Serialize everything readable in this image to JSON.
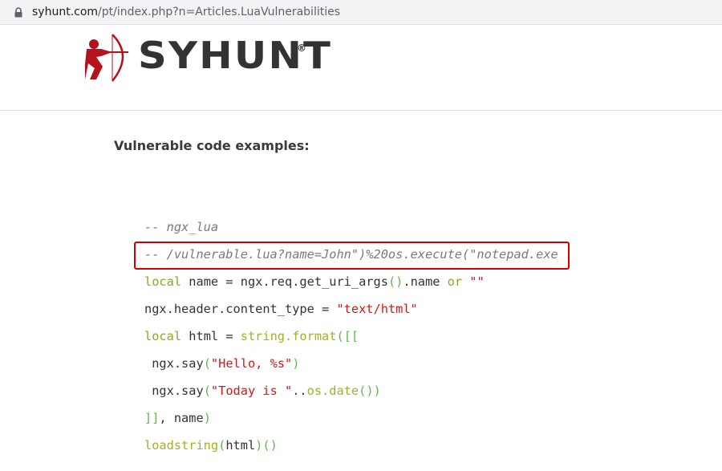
{
  "address_bar": {
    "domain": "syhunt.com",
    "path": "/pt/index.php?n=Articles.LuaVulnerabilities",
    "lock_icon": "lock-icon"
  },
  "header": {
    "logo_text": "SYHUNT",
    "logo_registered": "®",
    "logo_color": "#b5121b"
  },
  "content": {
    "heading": "Vulnerable code examples:",
    "code_lines": [
      {
        "tokens": [
          {
            "t": "-- ngx_lua",
            "c": "comment"
          }
        ]
      },
      {
        "tokens": [
          {
            "t": "-- /vulnerable.lua?name=John\")%20os.execute(\"notepad.exe",
            "c": "comment"
          }
        ],
        "highlighted": true
      },
      {
        "tokens": [
          {
            "t": "local",
            "c": "kw"
          },
          {
            "t": " name = ngx.req.get_uri_args",
            "c": "plain"
          },
          {
            "t": "()",
            "c": "punc"
          },
          {
            "t": ".name ",
            "c": "plain"
          },
          {
            "t": "or",
            "c": "kw"
          },
          {
            "t": " ",
            "c": "plain"
          },
          {
            "t": "\"\"",
            "c": "str"
          }
        ]
      },
      {
        "tokens": [
          {
            "t": "ngx.header.content_type = ",
            "c": "plain"
          },
          {
            "t": "\"text/html\"",
            "c": "str"
          }
        ]
      },
      {
        "tokens": [
          {
            "t": "local",
            "c": "kw"
          },
          {
            "t": " html = ",
            "c": "plain"
          },
          {
            "t": "string.format",
            "c": "fn"
          },
          {
            "t": "([[",
            "c": "punc"
          }
        ]
      },
      {
        "tokens": [
          {
            "t": " ngx.say",
            "c": "plain"
          },
          {
            "t": "(",
            "c": "punc"
          },
          {
            "t": "\"Hello, %s\"",
            "c": "str"
          },
          {
            "t": ")",
            "c": "punc"
          }
        ]
      },
      {
        "tokens": [
          {
            "t": " ngx.say",
            "c": "plain"
          },
          {
            "t": "(",
            "c": "punc"
          },
          {
            "t": "\"Today is \"",
            "c": "str"
          },
          {
            "t": "..",
            "c": "plain"
          },
          {
            "t": "os.date",
            "c": "fn"
          },
          {
            "t": "())",
            "c": "punc"
          }
        ]
      },
      {
        "tokens": [
          {
            "t": "]]",
            "c": "punc"
          },
          {
            "t": ", name",
            "c": "plain"
          },
          {
            "t": ")",
            "c": "punc"
          }
        ]
      },
      {
        "tokens": [
          {
            "t": "loadstring",
            "c": "fn"
          },
          {
            "t": "(",
            "c": "punc"
          },
          {
            "t": "html",
            "c": "plain"
          },
          {
            "t": ")()",
            "c": "punc"
          }
        ]
      }
    ]
  }
}
